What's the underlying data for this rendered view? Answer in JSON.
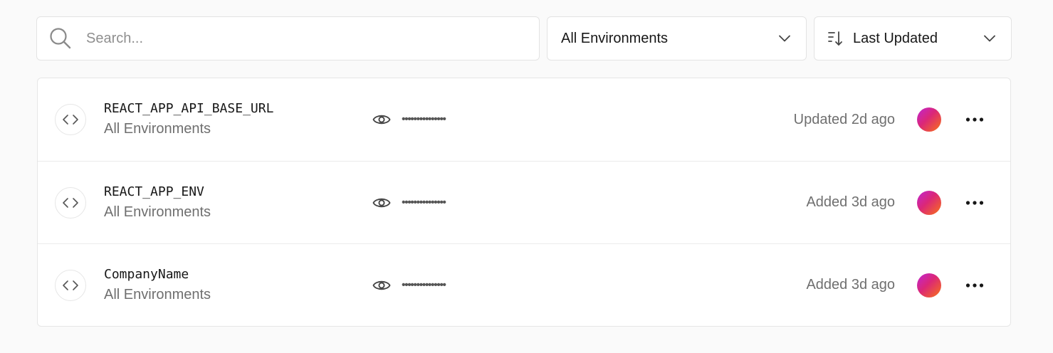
{
  "search": {
    "placeholder": "Search...",
    "value": "",
    "icon": "search-icon"
  },
  "env_filter": {
    "selected": "All Environments",
    "icon": "chevron-down-icon"
  },
  "sort": {
    "selected": "Last Updated",
    "icon": "sort-descending-icon"
  },
  "variables": [
    {
      "name": "REACT_APP_API_BASE_URL",
      "environment": "All Environments",
      "masked_value": "•••••••••••••••",
      "status": "Updated 2d ago"
    },
    {
      "name": "REACT_APP_ENV",
      "environment": "All Environments",
      "masked_value": "•••••••••••••••",
      "status": "Added 3d ago"
    },
    {
      "name": "CompanyName",
      "environment": "All Environments",
      "masked_value": "•••••••••••••••",
      "status": "Added 3d ago"
    }
  ],
  "colors": {
    "background": "#fafafa",
    "border": "#e3e3e3",
    "muted_text": "#6f6f6f",
    "avatar_gradient": [
      "#c026d3",
      "#db2777",
      "#f97316"
    ]
  }
}
